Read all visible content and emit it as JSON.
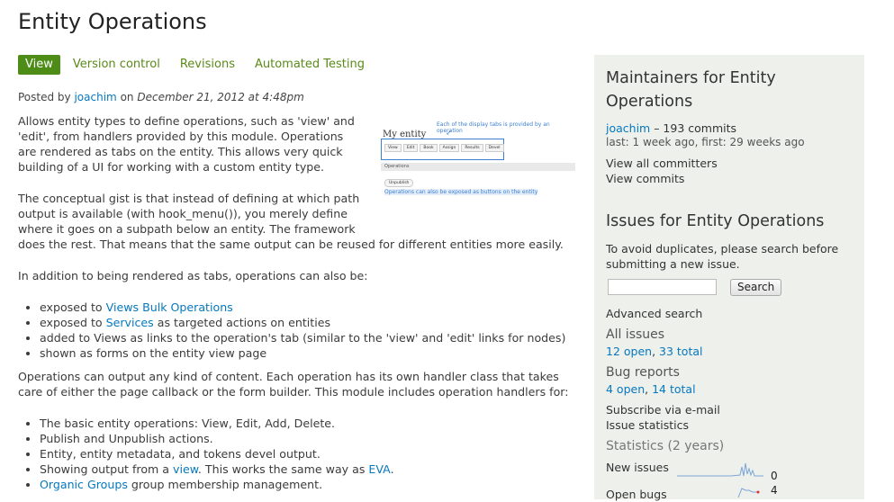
{
  "page": {
    "title": "Entity Operations"
  },
  "tabs": [
    {
      "label": "View",
      "active": true
    },
    {
      "label": "Version control"
    },
    {
      "label": "Revisions"
    },
    {
      "label": "Automated Testing"
    }
  ],
  "posted": {
    "prefix": "Posted by",
    "author": "joachim",
    "on": "on",
    "date": "December 21, 2012 at 4:48pm"
  },
  "thumbnail": {
    "annotation_top": "Each of the display tabs is provided by an operation",
    "entity_title": "My entity",
    "tabs": [
      "View",
      "Edit",
      "Book",
      "Assign",
      "Results",
      "Devel"
    ],
    "ops_label": "Operations",
    "unpublish": "Unpublish",
    "annotation_bottom": "Operations can also be exposed as buttons on the entity"
  },
  "body": {
    "p1": [
      "Allows entity types to define operations, such as 'view' and",
      "'edit', from handlers provided by this module. Operations",
      "are rendered as tabs on the entity. This allows very quick",
      "building of a UI for working with a custom entity type."
    ],
    "p2": [
      "The conceptual gist is that instead of defining at which path",
      "output is available (with hook_menu()), you merely define",
      "where it goes on a subpath below an entity. The framework",
      "does the rest. That means that the same output can be reused for different entities more easily."
    ],
    "p3": "In addition to being rendered as tabs, operations can also be:",
    "list1": [
      {
        "pre": "exposed to ",
        "link": "Views Bulk Operations",
        "post": ""
      },
      {
        "pre": "exposed to ",
        "link": "Services",
        "post": " as targeted actions on entities"
      },
      {
        "pre": "added to Views as links to the operation's tab (similar to the 'view' and 'edit' links for nodes)",
        "link": "",
        "post": ""
      },
      {
        "pre": "shown as forms on the entity view page",
        "link": "",
        "post": ""
      }
    ],
    "p4": [
      "Operations can output any kind of content. Each operation has its own handler class that takes",
      "care of either the page callback or the form builder. This module includes operation handlers for:"
    ],
    "list2": [
      {
        "pre": "The basic entity operations: View, Edit, Add, Delete.",
        "link": "",
        "mid": "",
        "link2": "",
        "post": ""
      },
      {
        "pre": "Publish and Unpublish actions.",
        "link": "",
        "mid": "",
        "link2": "",
        "post": ""
      },
      {
        "pre": "Entity, entity metadata, and tokens devel output.",
        "link": "",
        "mid": "",
        "link2": "",
        "post": ""
      },
      {
        "pre": "Showing output from a ",
        "link": "view",
        "mid": ". This works the same way as ",
        "link2": "EVA",
        "post": "."
      },
      {
        "pre": "",
        "link": "Organic Groups",
        "mid": " group membership management.",
        "link2": "",
        "post": ""
      }
    ]
  },
  "sidebar": {
    "maintainers_title": [
      "Maintainers for Entity",
      "Operations"
    ],
    "maintainer": {
      "name": "joachim",
      "commits": " – 193 commits",
      "meta": "last: 1 week ago, first: 29 weeks ago"
    },
    "view_all_committers": "View all committers",
    "view_commits": "View commits",
    "issues_title": "Issues for Entity Operations",
    "avoid_text": [
      "To avoid duplicates, please search before",
      "submitting a new issue."
    ],
    "search_button": "Search",
    "advanced_search": "Advanced search",
    "all_issues": {
      "label": "All issues",
      "open": "12 open",
      "sep": ", ",
      "total": "33 total"
    },
    "bug_reports": {
      "label": "Bug reports",
      "open": "4 open",
      "sep": ", ",
      "total": "14 total"
    },
    "subscribe": "Subscribe via e-mail",
    "issue_statistics": "Issue statistics",
    "statistics": {
      "label": "Statistics",
      "period": " (2 years)"
    },
    "new_issues": {
      "label": "New issues",
      "value": "0"
    },
    "open_bugs": {
      "label": "Open bugs",
      "value": "4"
    },
    "colors": {
      "spark": "#7aa6d8",
      "marker": "#d33"
    }
  }
}
